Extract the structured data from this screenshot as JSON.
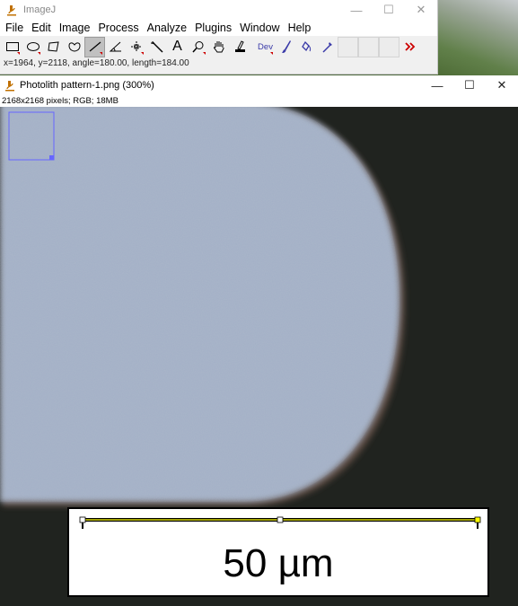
{
  "main_window": {
    "title": "ImageJ",
    "menu": [
      "File",
      "Edit",
      "Image",
      "Process",
      "Analyze",
      "Plugins",
      "Window",
      "Help"
    ],
    "tools": [
      {
        "name": "rectangle-tool-icon",
        "selected": false
      },
      {
        "name": "oval-tool-icon",
        "selected": false
      },
      {
        "name": "polygon-tool-icon",
        "selected": false
      },
      {
        "name": "freehand-tool-icon",
        "selected": false
      },
      {
        "name": "straight-line-tool-icon",
        "selected": true
      },
      {
        "name": "angle-tool-icon",
        "selected": false
      },
      {
        "name": "multipoint-tool-icon",
        "selected": false
      },
      {
        "name": "wand-tool-icon",
        "selected": false
      },
      {
        "name": "text-tool-icon",
        "selected": false
      },
      {
        "name": "magnifier-tool-icon",
        "selected": false
      },
      {
        "name": "hand-tool-icon",
        "selected": false
      },
      {
        "name": "color-picker-tool-icon",
        "selected": false
      },
      {
        "name": "dev-tool-icon",
        "selected": false
      },
      {
        "name": "brush-tool-icon",
        "selected": false
      },
      {
        "name": "flood-fill-tool-icon",
        "selected": false
      },
      {
        "name": "pipette-tool-icon",
        "selected": false
      },
      {
        "name": "more-tools-icon",
        "selected": false
      }
    ],
    "dev_label": "Dev",
    "text_tool_label": "A",
    "status": "x=1964, y=2118, angle=180.00, length=184.00"
  },
  "image_window": {
    "title": "Photolith pattern-1.png (300%)",
    "info": "2168x2168 pixels; RGB; 18MB",
    "scale_bar_label": "50 µm"
  },
  "colors": {
    "pattern_fill": "#a3b0c6",
    "background": "#20231f",
    "selection": "#6666ff",
    "line_selection_handle": "#ffff00"
  }
}
